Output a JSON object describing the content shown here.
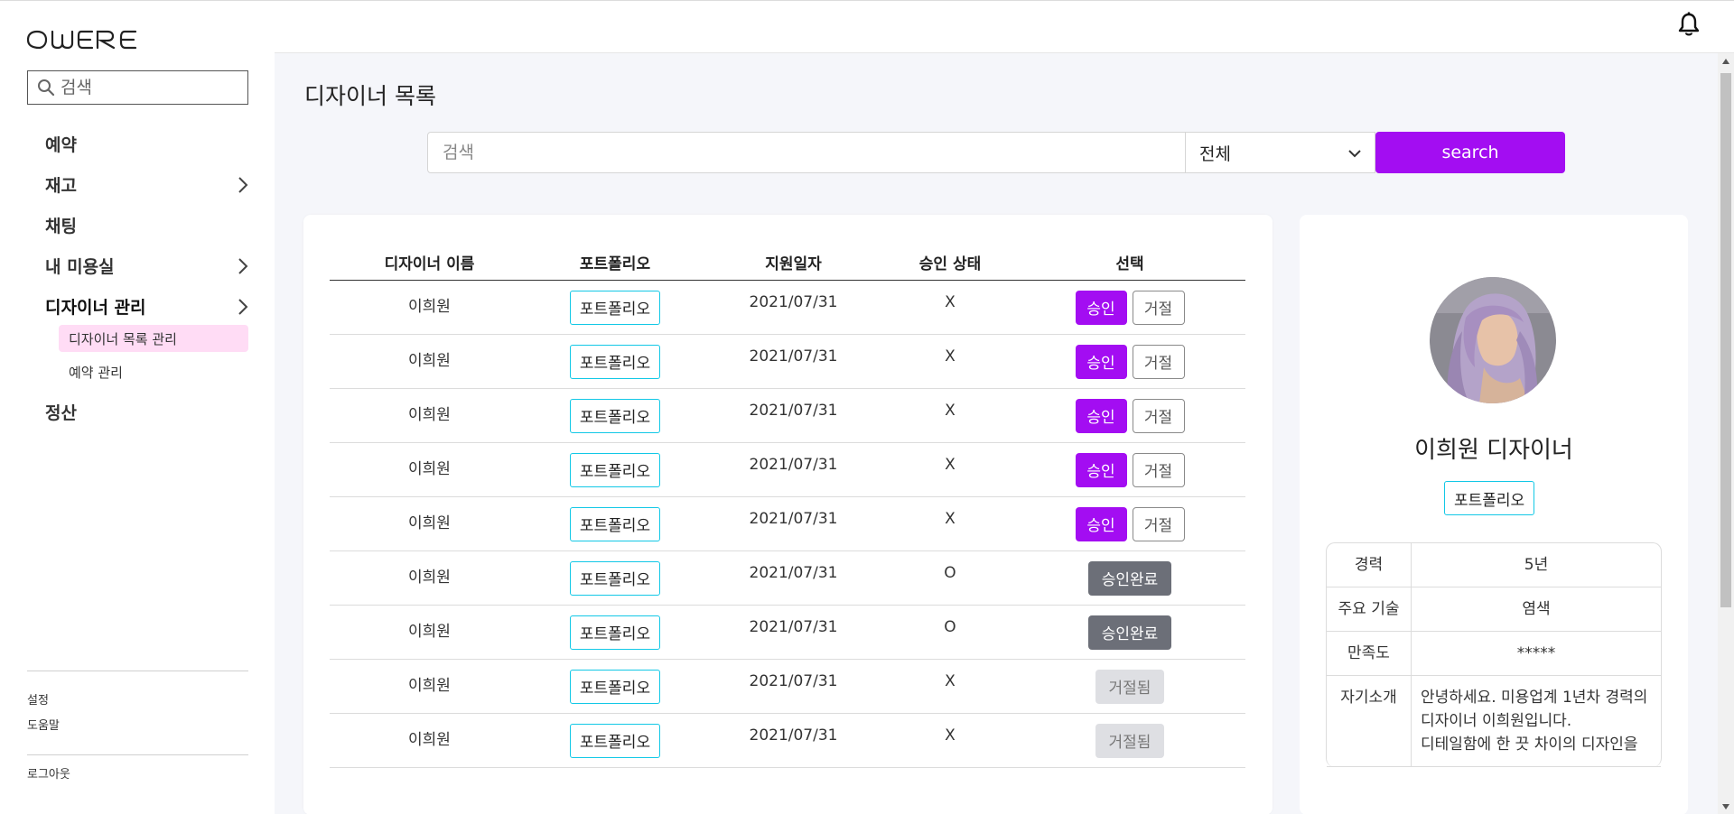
{
  "app": {
    "logo_text": "OWERE"
  },
  "sidebar": {
    "search_placeholder": "검색",
    "items": [
      {
        "label": "예약",
        "has_children": false
      },
      {
        "label": "재고",
        "has_children": true
      },
      {
        "label": "채팅",
        "has_children": false
      },
      {
        "label": "내 미용실",
        "has_children": true
      },
      {
        "label": "디자이너 관리",
        "has_children": true
      }
    ],
    "subitems": [
      {
        "label": "디자이너 목록 관리",
        "active": true
      },
      {
        "label": "예약 관리",
        "active": false
      }
    ],
    "last_item": {
      "label": "정산"
    },
    "footer": {
      "settings": "설정",
      "help": "도움말",
      "logout": "로그아웃"
    }
  },
  "topbar": {
    "bell_icon": "bell-icon"
  },
  "page": {
    "title": "디자이너 목록"
  },
  "search": {
    "placeholder": "검색",
    "filter_value": "전체",
    "button_label": "search"
  },
  "table": {
    "headers": [
      "디자이너 이름",
      "포트폴리오",
      "지원일자",
      "승인 상태",
      "선택"
    ],
    "rows": [
      {
        "name": "이희원",
        "portfolio": "포트폴리오",
        "date": "2021/07/31",
        "status": "X",
        "action": "pending"
      },
      {
        "name": "이희원",
        "portfolio": "포트폴리오",
        "date": "2021/07/31",
        "status": "X",
        "action": "pending"
      },
      {
        "name": "이희원",
        "portfolio": "포트폴리오",
        "date": "2021/07/31",
        "status": "X",
        "action": "pending"
      },
      {
        "name": "이희원",
        "portfolio": "포트폴리오",
        "date": "2021/07/31",
        "status": "X",
        "action": "pending"
      },
      {
        "name": "이희원",
        "portfolio": "포트폴리오",
        "date": "2021/07/31",
        "status": "X",
        "action": "pending"
      },
      {
        "name": "이희원",
        "portfolio": "포트폴리오",
        "date": "2021/07/31",
        "status": "O",
        "action": "approved"
      },
      {
        "name": "이희원",
        "portfolio": "포트폴리오",
        "date": "2021/07/31",
        "status": "O",
        "action": "approved"
      },
      {
        "name": "이희원",
        "portfolio": "포트폴리오",
        "date": "2021/07/31",
        "status": "X",
        "action": "rejected"
      },
      {
        "name": "이희원",
        "portfolio": "포트폴리오",
        "date": "2021/07/31",
        "status": "X",
        "action": "rejected"
      }
    ],
    "approve_label": "승인",
    "reject_label": "거절",
    "approved_label": "승인완료",
    "rejected_label": "거절됨"
  },
  "detail": {
    "name": "이희원 디자이너",
    "portfolio_label": "포트폴리오",
    "info": [
      {
        "label": "경력",
        "value": "5년"
      },
      {
        "label": "주요 기술",
        "value": "염색"
      },
      {
        "label": "만족도",
        "value": "*****"
      },
      {
        "label": "자기소개",
        "value": "안녕하세요. 미용업계 1년차 경력의\n디자이너 이희원입니다.\n디테일함에 한 끗 차이의 디자인을"
      }
    ]
  },
  "colors": {
    "accent": "#a30df2",
    "portfolio_border": "#12c8e6",
    "active_sub_bg": "#ffdcf5",
    "approved_btn": "#6c6f78"
  }
}
